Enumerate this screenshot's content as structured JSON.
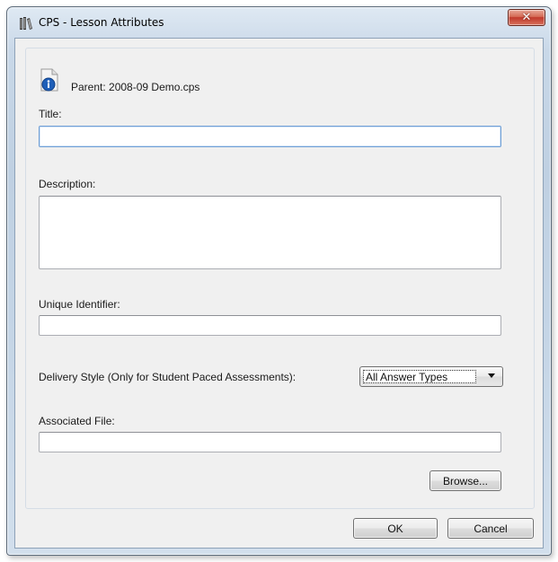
{
  "window": {
    "title": "CPS - Lesson Attributes",
    "app_icon": "books-icon",
    "close_glyph": "✕"
  },
  "parent": {
    "icon": "document-info-icon",
    "text": "Parent: 2008-09 Demo.cps"
  },
  "fields": {
    "title": {
      "label": "Title:",
      "value": ""
    },
    "description": {
      "label": "Description:",
      "value": ""
    },
    "unique_identifier": {
      "label": "Unique Identifier:",
      "value": ""
    },
    "delivery_style": {
      "label": "Delivery Style (Only for Student Paced Assessments):",
      "selected": "All Answer Types"
    },
    "associated_file": {
      "label": "Associated File:",
      "value": ""
    }
  },
  "buttons": {
    "browse": "Browse...",
    "ok": "OK",
    "cancel": "Cancel"
  },
  "colors": {
    "close_button": "#c0392b",
    "focus_border": "#6f9fd6",
    "dialog_face": "#f0f0f0"
  }
}
